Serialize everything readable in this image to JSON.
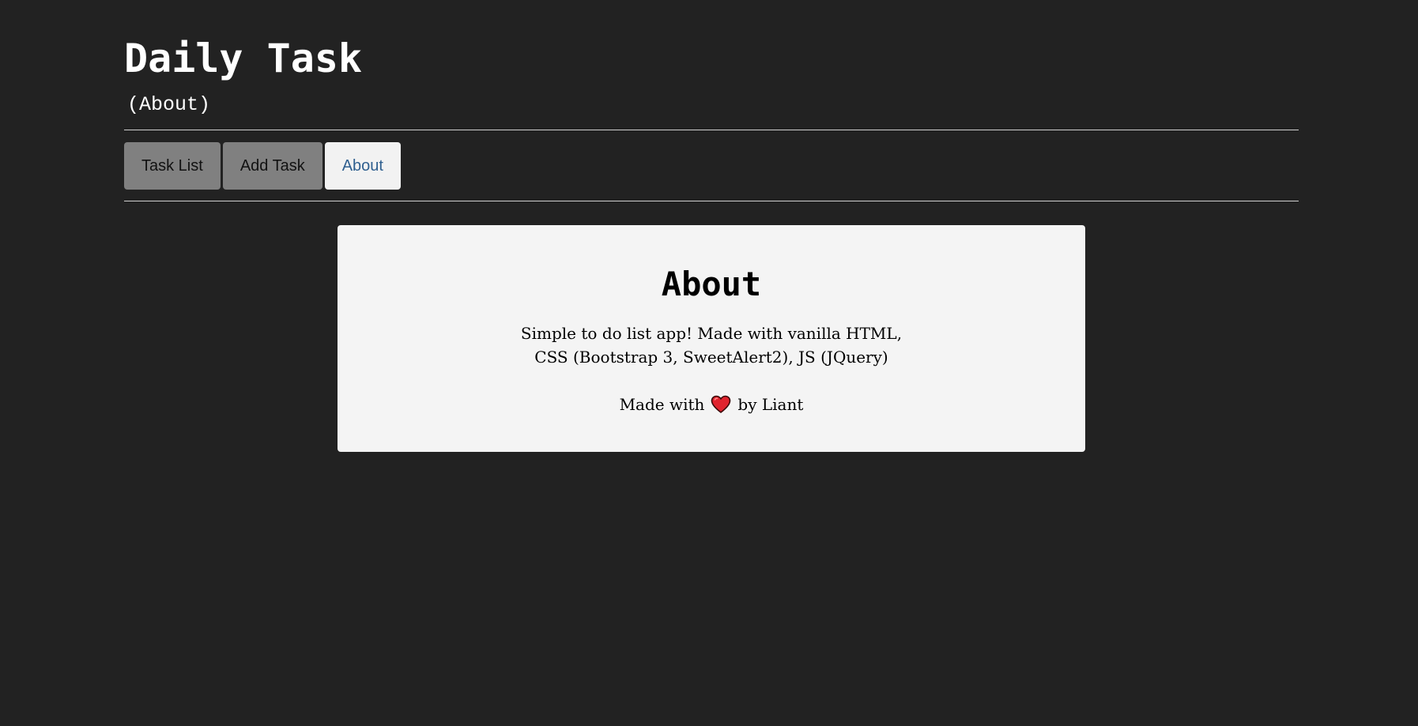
{
  "header": {
    "title": "Daily Task",
    "subtitle": "(About)"
  },
  "nav": {
    "tabs": [
      {
        "label": "Task List",
        "active": false
      },
      {
        "label": "Add Task",
        "active": false
      },
      {
        "label": "About",
        "active": true
      }
    ]
  },
  "about": {
    "heading": "About",
    "description_line1": "Simple to do list app! Made with vanilla HTML,",
    "description_line2": "CSS (Bootstrap 3, SweetAlert2), JS (JQuery)",
    "credit_prefix": "Made with",
    "credit_icon": "heart-icon",
    "credit_suffix": "by Liant"
  },
  "colors": {
    "background": "#222222",
    "tab_inactive": "#808080",
    "tab_active": "#f2f2f2",
    "tab_active_text": "#2f5f8f",
    "card": "#f4f4f4",
    "heart": "#e0232e"
  }
}
